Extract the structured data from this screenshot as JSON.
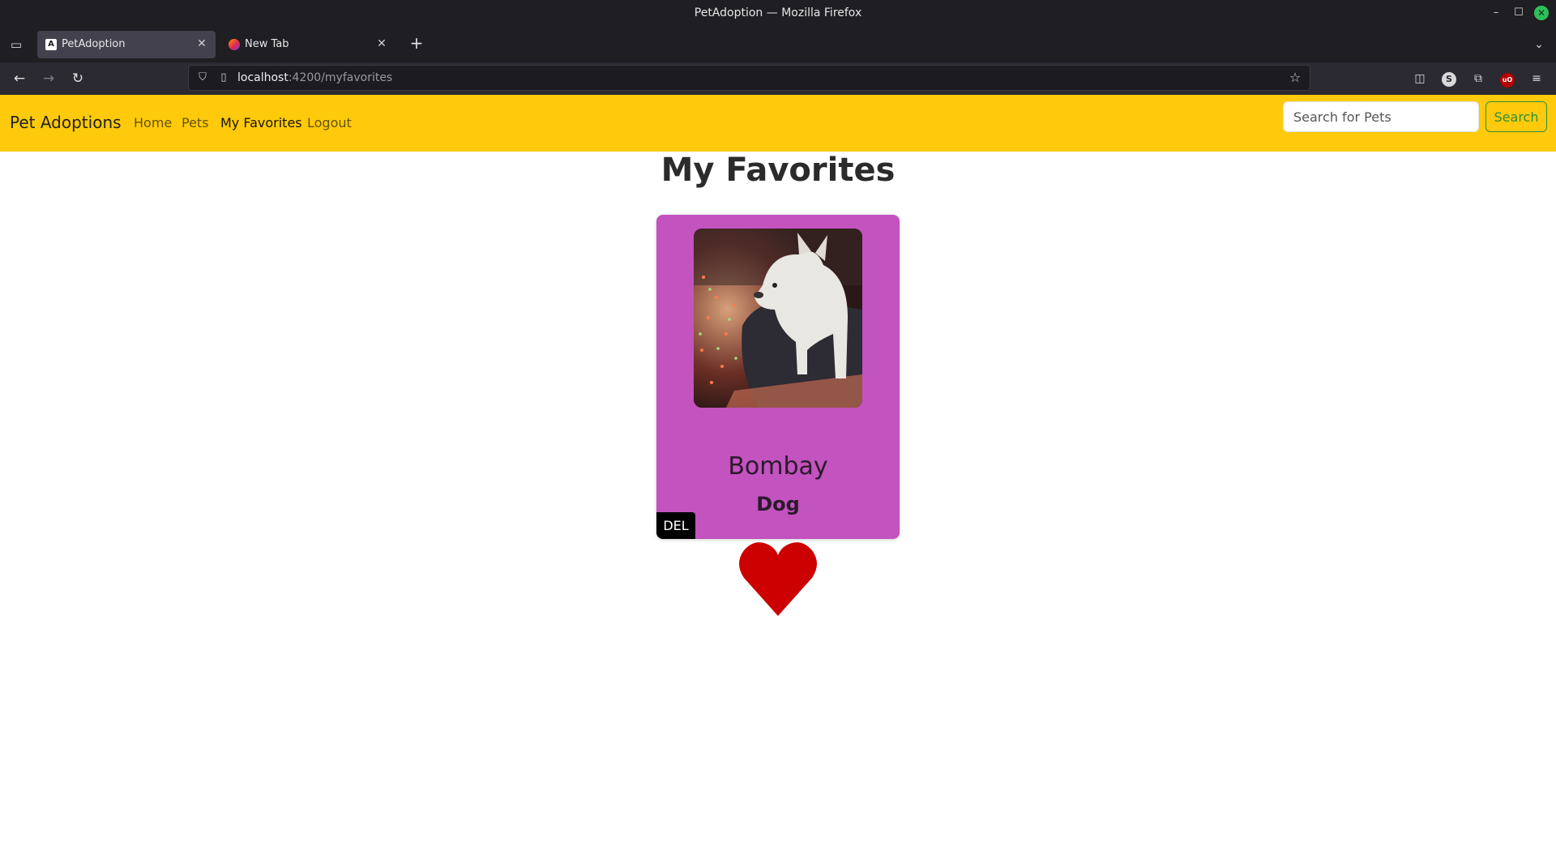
{
  "window": {
    "title": "PetAdoption — Mozilla Firefox",
    "controls": [
      "–",
      "☐",
      "✕"
    ]
  },
  "tabs": [
    {
      "label": "PetAdoption",
      "favicon": "A",
      "active": true
    },
    {
      "label": "New Tab",
      "favicon": "",
      "active": false
    }
  ],
  "toolbar": {
    "url_host": "localhost",
    "url_path": ":4200/myfavorites",
    "sync_letter": "S",
    "ublock_letter": "uO"
  },
  "site": {
    "brand": "Pet Adoptions",
    "nav": {
      "home": "Home",
      "pets": "Pets",
      "favorites": "My Favorites",
      "logout": "Logout"
    },
    "search": {
      "placeholder": "Search for Pets",
      "button": "Search"
    },
    "colors": {
      "navbar": "#ffca0b",
      "card": "#c253bf",
      "heart": "#cc0000",
      "search_button": "#2f8f3a"
    }
  },
  "main": {
    "title": "My Favorites",
    "favorites": [
      {
        "name": "Bombay",
        "type": "Dog",
        "delete_label": "DEL",
        "favorited": true
      }
    ]
  }
}
